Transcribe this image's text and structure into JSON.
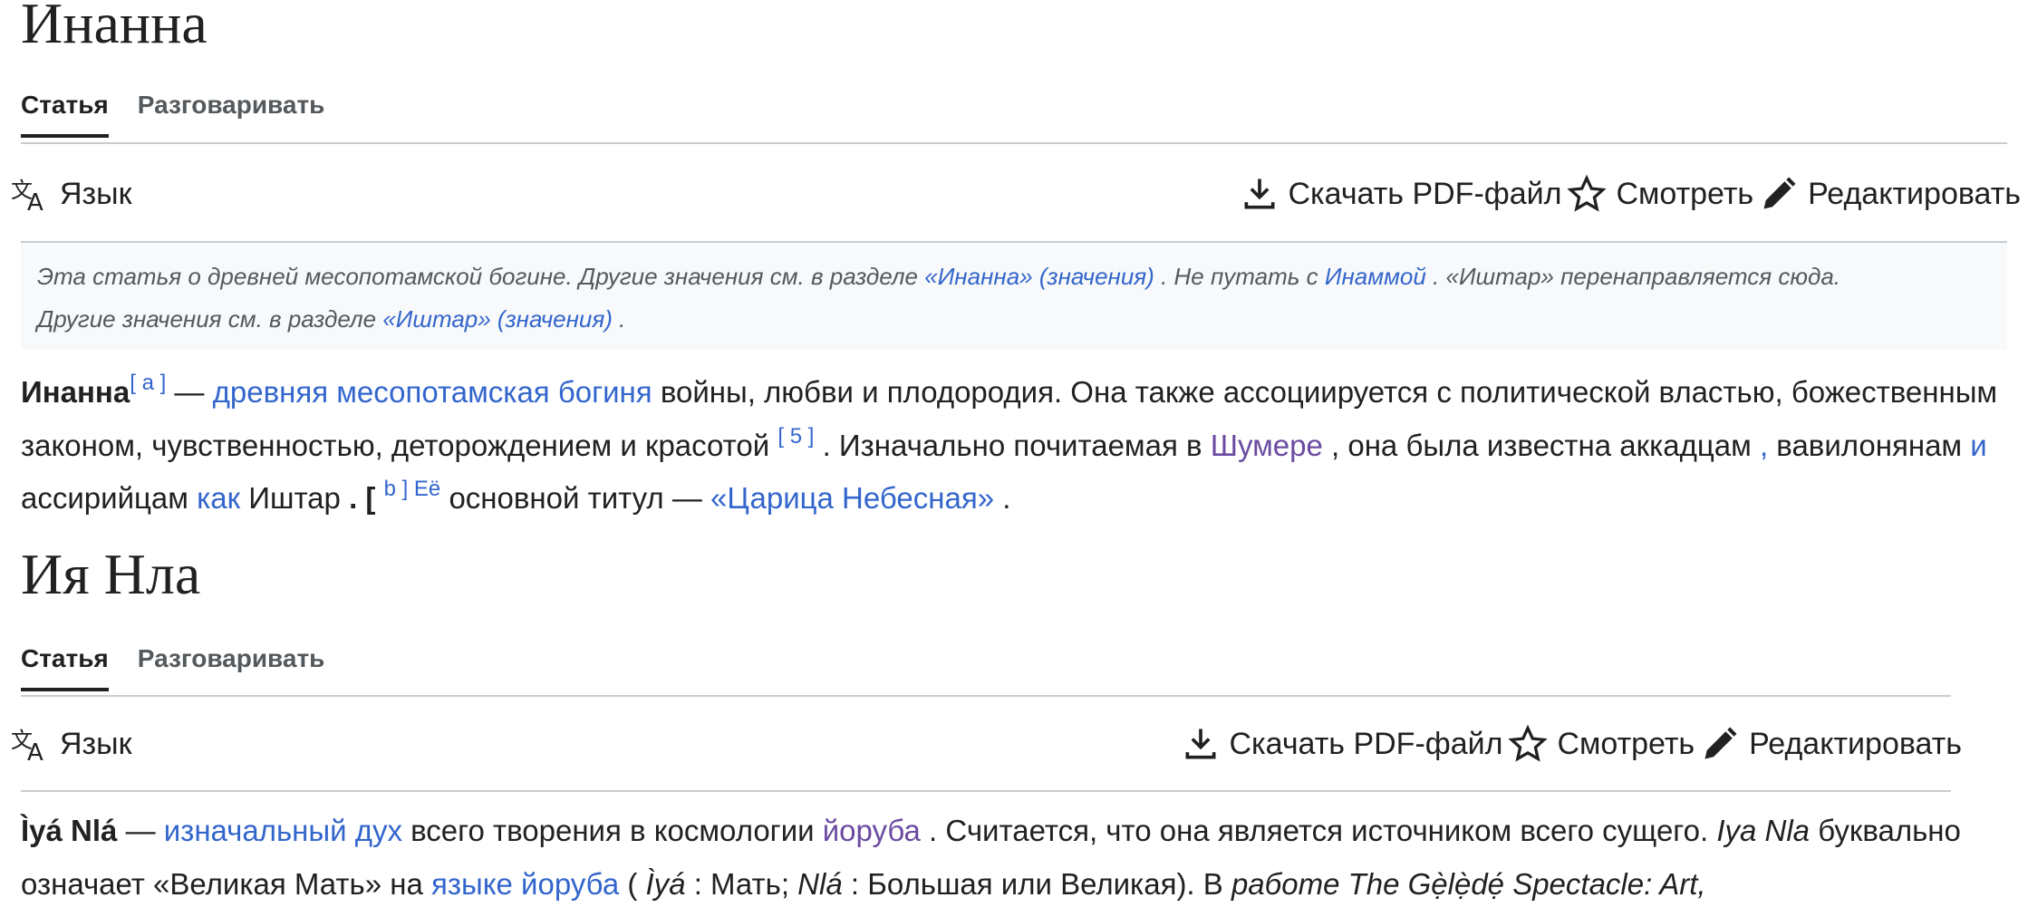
{
  "article1": {
    "title": "Инанна",
    "tabs": [
      "Статья",
      "Разговаривать"
    ],
    "toolbar": {
      "language": "Язык",
      "download": "Скачать PDF-файл",
      "watch": "Смотреть",
      "edit": "Редактировать"
    },
    "hatnote": {
      "t1": "Эта статья о древней месопотамской богине. Другие значения см. в разделе ",
      "l1": "«Инанна» (значения)",
      "t2": " . Не путать с ",
      "l2": "Инаммой",
      "t3": " . «Иштар» перенаправляется сюда.",
      "t4": "Другие значения см. в разделе ",
      "l3": "«Иштар» (значения)",
      "t5": " ."
    },
    "body": {
      "name": "Инанна",
      "sup_a": "[ a ]",
      "t1": " — ",
      "l1": "древняя месопотамская богиня",
      "t2": " войны, любви и плодородия. Она также ассоциируется с политической властью, божественным законом, чувственностью, деторождением и красотой ",
      "sup_5": "[ 5 ]",
      "t3": " . Изначально почитаемая в ",
      "l2": "Шумере",
      "t4": " , она была известна аккадцам ",
      "l3": ",",
      "t5": " вавилонянам ",
      "l4": "и",
      "t6": " ассирийцам ",
      "l5": "как",
      "t7": " Иштар ",
      "t8": ". [ ",
      "sup_b": "b ] Её",
      "t9": " основной титул — ",
      "l6": "«Царица Небесная»",
      "t10": " ."
    }
  },
  "article2": {
    "title": "Ия Нла",
    "tabs": [
      "Статья",
      "Разговаривать"
    ],
    "toolbar": {
      "language": "Язык",
      "download": "Скачать PDF-файл",
      "watch": "Смотреть",
      "edit": "Редактировать"
    },
    "body": {
      "name": "Ìyá Nlá",
      "t1": " — ",
      "l1": "изначальный дух",
      "t2": " всего творения в космологии ",
      "l2": "йоруба",
      "t3": " . Считается, что она является источником всего сущего. ",
      "i1": "Iya Nla",
      "t4": " буквально означает «Великая Мать» на ",
      "l3": "языке йоруба",
      "t5": " ( ",
      "i2": "Ìyá",
      "t6": " : Мать; ",
      "i3": "Nlá",
      "t7": " : Большая или Великая). В ",
      "i4": "работе The Gẹ̀lẹ̀dẹ́ Spectacle: Art,"
    }
  }
}
